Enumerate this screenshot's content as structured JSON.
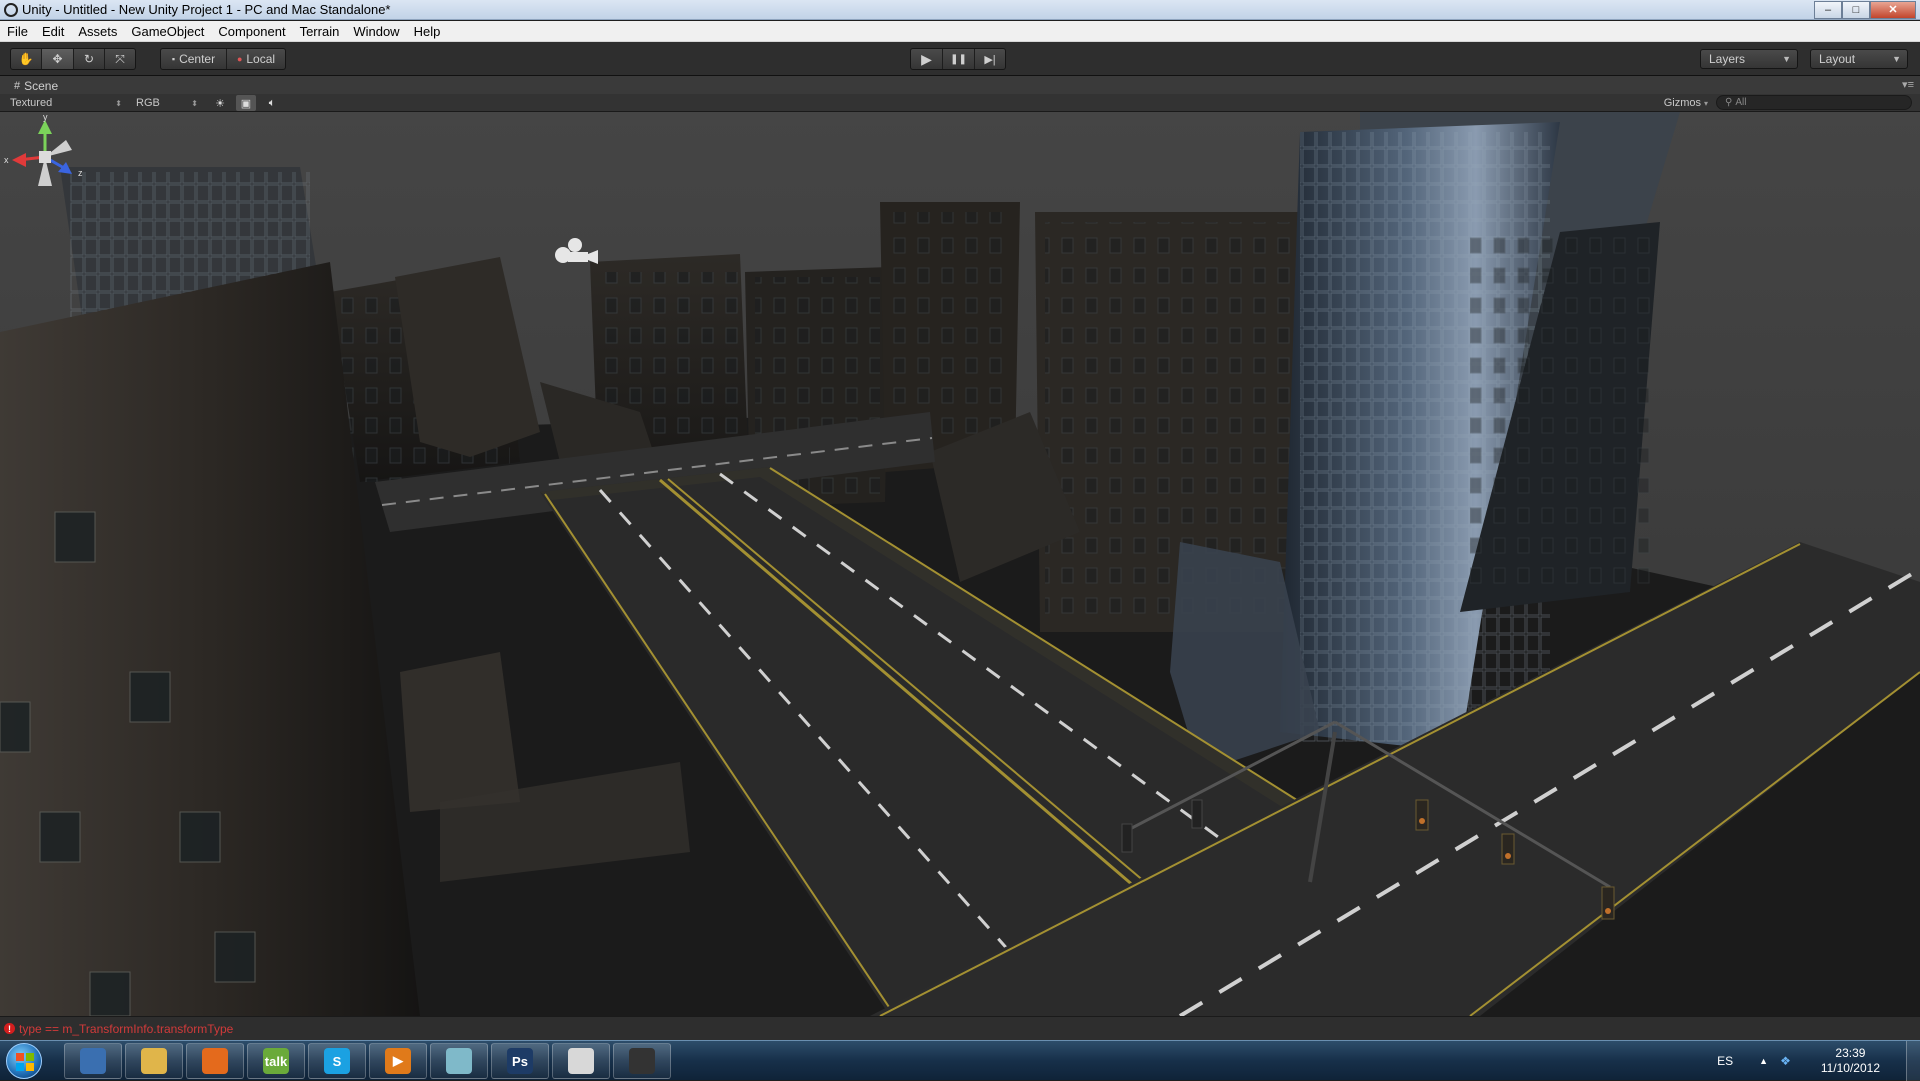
{
  "window": {
    "title": "Unity - Untitled - New Unity Project 1 - PC and Mac Standalone*",
    "minimize": "–",
    "maximize": "□",
    "close": "✕"
  },
  "menu": [
    "File",
    "Edit",
    "Assets",
    "GameObject",
    "Component",
    "Terrain",
    "Window",
    "Help"
  ],
  "toolbar": {
    "tools": [
      {
        "name": "hand-tool",
        "icon": "hand-icon",
        "glyph": "✋"
      },
      {
        "name": "move-tool",
        "icon": "move-icon",
        "glyph": "✥"
      },
      {
        "name": "rotate-tool",
        "icon": "rotate-icon",
        "glyph": "↻"
      },
      {
        "name": "scale-tool",
        "icon": "scale-icon",
        "glyph": "⤧"
      }
    ],
    "pivot_center": "Center",
    "pivot_local": "Local",
    "play": "▶",
    "pause": "❚❚",
    "step": "▶|",
    "layers": "Layers",
    "layout": "Layout"
  },
  "scene": {
    "tab_label": "Scene",
    "render_mode": "Textured",
    "channel": "RGB",
    "gizmos": "Gizmos",
    "search_placeholder": "All",
    "axes": {
      "x": "x",
      "y": "y",
      "z": "z"
    }
  },
  "status": {
    "error_text": "type == m_TransformInfo.transformType"
  },
  "taskbar": {
    "apps": [
      {
        "name": "network-app",
        "label": "",
        "color": "#3a6fb0"
      },
      {
        "name": "explorer-app",
        "label": "",
        "color": "#e0b54a"
      },
      {
        "name": "firefox-app",
        "label": "",
        "color": "#e46a1c"
      },
      {
        "name": "gtalk-app",
        "label": "talk",
        "color": "#6aaa3a"
      },
      {
        "name": "skype-app",
        "label": "S",
        "color": "#1ba1e2"
      },
      {
        "name": "media-app",
        "label": "▶",
        "color": "#e07a1a"
      },
      {
        "name": "paint-app",
        "label": "",
        "color": "#7fb9c9"
      },
      {
        "name": "photoshop-app",
        "label": "Ps",
        "color": "#1d3b66"
      },
      {
        "name": "notepad-app",
        "label": "",
        "color": "#d8d8d8"
      },
      {
        "name": "unity-app",
        "label": "",
        "color": "#333333"
      }
    ],
    "language": "ES",
    "time": "23:39",
    "date": "11/10/2012"
  }
}
